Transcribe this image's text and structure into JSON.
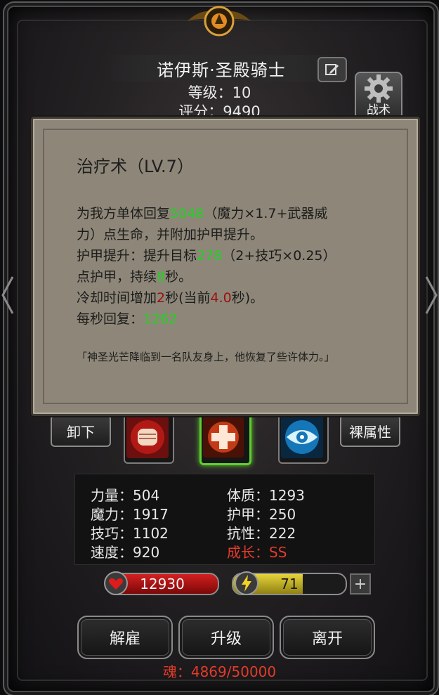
{
  "header": {
    "hero_name": "诺伊斯·圣殿骑士",
    "level_text": "等级：10",
    "score_text": "评分：9490",
    "gear_button_label": "战术"
  },
  "skill_popup": {
    "title": "治疗术（LV.7）",
    "line1_pre": "为我方单体回复",
    "line1_value": "5048",
    "line1_post": "（魔力×1.7+武器威",
    "line2": "力）点生命，并附加护甲提升。",
    "line3_pre": "护甲提升：提升目标",
    "line3_value": "278",
    "line3_post": "（2+技巧×0.25）",
    "line4_pre": "点护甲，持续",
    "line4_value": "8",
    "line4_post": "秒。",
    "line5_pre": "冷却时间增加",
    "line5_value": "2",
    "line5_mid": "秒(当前",
    "line5_value2": "4.0",
    "line5_post": "秒)。",
    "line6_pre": "每秒回复：",
    "line6_value": "1262",
    "quote": "「神圣光芒降临到一名队友身上，他恢复了些许体力。」"
  },
  "skill_bar": {
    "unequip_label": "卸下",
    "bare_stats_label": "裸属性",
    "slots": [
      "fist-skill",
      "heal-skill",
      "eye-skill"
    ]
  },
  "stats": {
    "strength": "力量：504",
    "constitution": "体质：1293",
    "magic": "魔力：1917",
    "armor": "护甲：250",
    "skill": "技巧：1102",
    "resistance": "抗性：222",
    "speed": "速度：920",
    "growth": "成长：SS"
  },
  "resources": {
    "hp": "12930",
    "energy": "71",
    "energy_fraction": 0.62,
    "plus": "+"
  },
  "actions": {
    "dismiss": "解雇",
    "upgrade": "升级",
    "leave": "离开"
  },
  "footer": {
    "soul_text": "魂：4869/50000"
  },
  "colors": {
    "value_green": "#1fd31f",
    "value_red": "#9b1010",
    "growth_red": "#e23b2a",
    "hp_red": "#d42020",
    "energy_yellow": "#e6d33a",
    "selected_green": "#5ecf2e"
  }
}
